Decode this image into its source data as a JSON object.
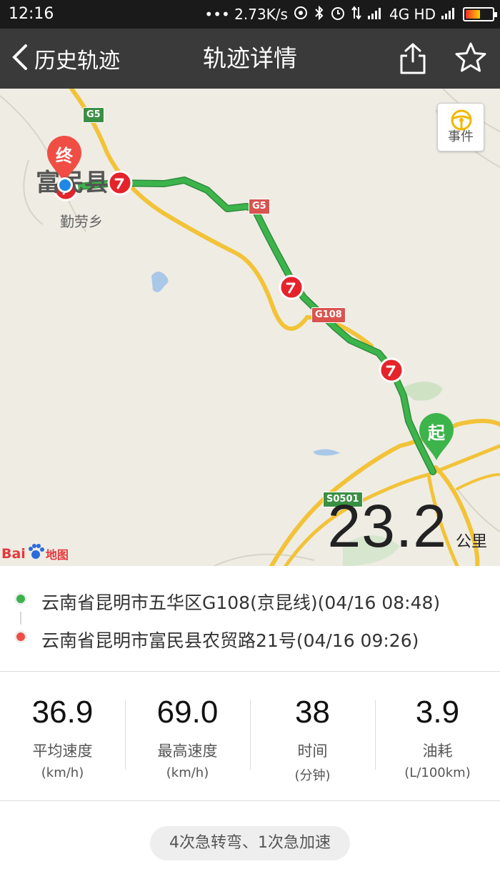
{
  "status_bar": {
    "time": "12:16",
    "network_speed": "••• 2.73K/s",
    "network_type": "4G HD",
    "icons": [
      "hotspot-icon",
      "bluetooth-icon",
      "alarm-icon",
      "data-arrows-icon",
      "signal-icon",
      "signal-icon",
      "battery-icon"
    ],
    "battery_level": 0.55
  },
  "header": {
    "back_label": "历史轨迹",
    "title": "轨迹详情",
    "share_icon": "share-icon",
    "favorite_icon": "star-icon",
    "color": "#3a3a3a"
  },
  "map": {
    "labels": {
      "county": "富民县",
      "township": "勤劳乡"
    },
    "road_shields": [
      "G5",
      "G5",
      "G108",
      "S0501"
    ],
    "start_marker": "起",
    "end_marker": "终",
    "event_button": "事件",
    "distance_value": "23.2",
    "distance_unit": "公里",
    "logo_text": "Bai",
    "logo_suffix": "地图",
    "route_color": "#3cb44b",
    "event_marker_color": "#e4232b"
  },
  "addresses": {
    "start": {
      "text": "云南省昆明市五华区G108(京昆线)(04/16 08:48)",
      "color": "#3cb44b"
    },
    "end": {
      "text": "云南省昆明市富民县农贸路21号(04/16 09:26)",
      "color": "#f04e45"
    }
  },
  "stats": [
    {
      "value": "36.9",
      "label": "平均速度",
      "unit": "(km/h)"
    },
    {
      "value": "69.0",
      "label": "最高速度",
      "unit": "(km/h)"
    },
    {
      "value": "38",
      "label": "时间",
      "unit": "(分钟)"
    },
    {
      "value": "3.9",
      "label": "油耗",
      "unit": "(L/100km)"
    }
  ],
  "summary": "4次急转弯、1次急加速"
}
